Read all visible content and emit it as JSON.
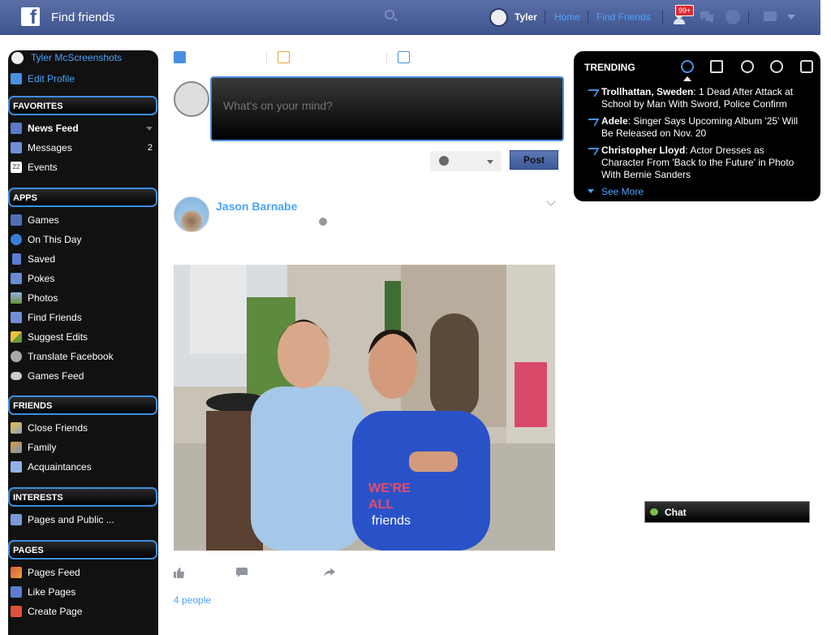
{
  "header": {
    "title": "Find friends",
    "user_name": "Tyler",
    "home_label": "Home",
    "find_friends_label": "Find Friends",
    "friend_requests_badge": "99+"
  },
  "sidebar": {
    "profile_name": "Tyler McScreenshots",
    "edit_profile": "Edit Profile",
    "sections": {
      "favorites": "FAVORITES",
      "apps": "APPS",
      "friends": "FRIENDS",
      "interests": "INTERESTS",
      "pages": "PAGES"
    },
    "favorites": [
      {
        "label": "News Feed"
      },
      {
        "label": "Messages",
        "count": "2"
      },
      {
        "label": "Events",
        "icon_text": "22"
      }
    ],
    "apps": [
      {
        "label": "Games"
      },
      {
        "label": "On This Day"
      },
      {
        "label": "Saved"
      },
      {
        "label": "Pokes"
      },
      {
        "label": "Photos"
      },
      {
        "label": "Find Friends"
      },
      {
        "label": "Suggest Edits"
      },
      {
        "label": "Translate Facebook"
      },
      {
        "label": "Games Feed"
      }
    ],
    "friends": [
      {
        "label": "Close Friends"
      },
      {
        "label": "Family"
      },
      {
        "label": "Acquaintances"
      }
    ],
    "interests": [
      {
        "label": "Pages and Public ..."
      }
    ],
    "pages": [
      {
        "label": "Pages Feed"
      },
      {
        "label": "Like Pages"
      },
      {
        "label": "Create Page"
      }
    ]
  },
  "composer": {
    "placeholder": "What's on your mind?",
    "post_label": "Post"
  },
  "post": {
    "author": "Jason Barnabe",
    "likes_text": "4 people",
    "photo_text": "friends"
  },
  "trending": {
    "title": "TRENDING",
    "items": [
      {
        "topic": "Trollhattan, Sweden",
        "text": ": 1 Dead After Attack at School by Man With Sword, Police Confirm"
      },
      {
        "topic": "Adele",
        "text": ": Singer Says Upcoming Album '25' Will Be Released on Nov. 20"
      },
      {
        "topic": "Christopher Lloyd",
        "text": ": Actor Dresses as Character From 'Back to the Future' in Photo With Bernie Sanders"
      }
    ],
    "see_more": "See More"
  },
  "chat": {
    "label": "Chat"
  },
  "colors": {
    "accent": "#4aa3ff",
    "header_blue": "#4b5f99",
    "badge_red": "#e0272f",
    "sidebar_bg": "#111111"
  }
}
